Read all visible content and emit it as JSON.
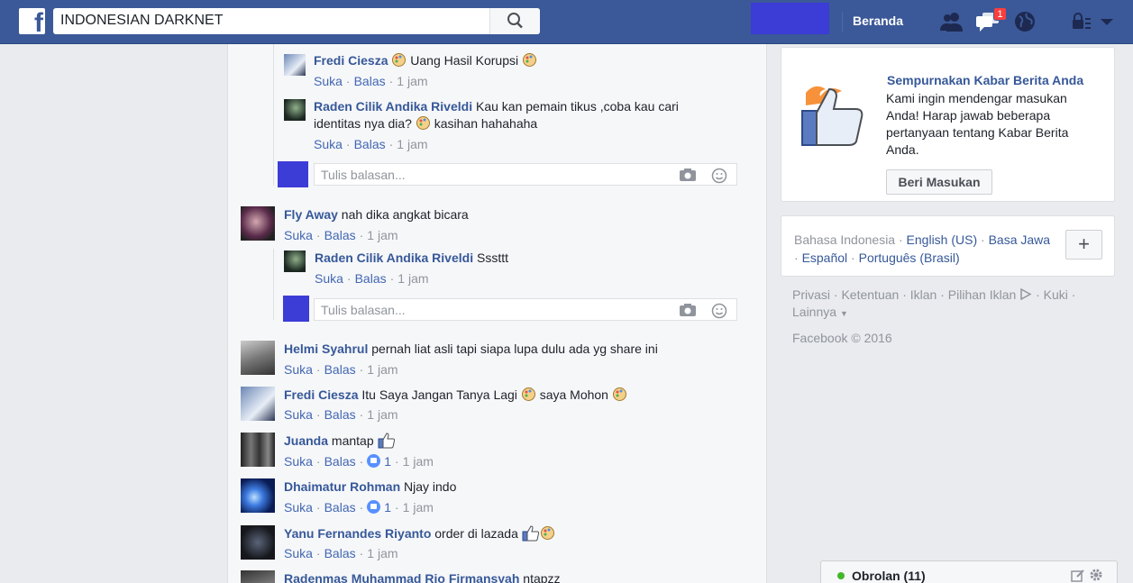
{
  "topbar": {
    "logo": "f",
    "search_value": "INDONESIAN DARKNET",
    "home_label": "Beranda",
    "notification_count": "1"
  },
  "icons": {
    "search": "search-icon",
    "friends": "friend-requests-icon",
    "messages": "messages-icon",
    "notifications": "globe-icon",
    "privacy": "privacy-shortcut-icon",
    "menu": "account-menu-chevron-icon"
  },
  "feed": {
    "reply_placeholder": "Tulis balasan...",
    "comments": [
      {
        "name": "Fredi Ciesza",
        "pre": "",
        "text": " Uang Hasil Korupsi ",
        "suka": "Suka",
        "balas": "Balas",
        "time": "1 jam"
      },
      {
        "name": "Raden Cilik Andika Riveldi",
        "text_line1": " Kau kan pemain tikus ,coba kau cari",
        "text_line2a": "identitas nya dia? ",
        "text_line2b": " kasihan hahahaha",
        "suka": "Suka",
        "balas": "Balas",
        "time": "1 jam"
      },
      {
        "name": "Fly Away",
        "text": " nah dika angkat bicara",
        "suka": "Suka",
        "balas": "Balas",
        "time": "1 jam"
      },
      {
        "name": "Raden Cilik Andika Riveldi",
        "text": " Sssttt",
        "suka": "Suka",
        "balas": "Balas",
        "time": "1 jam"
      },
      {
        "name": "Helmi Syahrul",
        "text": " pernah liat asli tapi siapa lupa dulu ada yg share ini",
        "suka": "Suka",
        "balas": "Balas",
        "time": "1 jam"
      },
      {
        "name": "Fredi Ciesza",
        "text": " Itu Saya Jangan Tanya Lagi ",
        "text2": " saya Mohon ",
        "suka": "Suka",
        "balas": "Balas",
        "time": "1 jam"
      },
      {
        "name": "Juanda",
        "text": " mantap ",
        "suka": "Suka",
        "balas": "Balas",
        "likes": "1",
        "time": "1 jam"
      },
      {
        "name": "Dhaimatur Rohman",
        "text": " Njay indo",
        "suka": "Suka",
        "balas": "Balas",
        "likes": "1",
        "time": "1 jam"
      },
      {
        "name": "Yanu Fernandes Riyanto",
        "text": " order di lazada ",
        "suka": "Suka",
        "balas": "Balas",
        "time": "1 jam"
      },
      {
        "name": "Radenmas Muhammad Rio Firmansyah",
        "text": " ntapzz"
      }
    ]
  },
  "feedback": {
    "title": "Sempurnakan Kabar Berita Anda",
    "body": "Kami ingin mendengar masukan Anda! Harap jawab beberapa pertanyaan tentang Kabar Berita Anda.",
    "button": "Beri Masukan"
  },
  "languages": {
    "current": "Bahasa Indonesia",
    "l1": "English (US)",
    "l2": "Basa Jawa",
    "l3": "Español",
    "l4": "Português (Brasil)",
    "plus": "+"
  },
  "footer": {
    "privasi": "Privasi",
    "ketentuan": "Ketentuan",
    "iklan": "Iklan",
    "pilihan_iklan": "Pilihan Iklan",
    "kuki": "Kuki",
    "lainnya": "Lainnya",
    "copyright": "Facebook © 2016"
  },
  "chat": {
    "label": "Obrolan (11)"
  },
  "colors": {
    "brand": "#3b5998",
    "link": "#365899",
    "placeholder_block": "#3c3cd6"
  }
}
